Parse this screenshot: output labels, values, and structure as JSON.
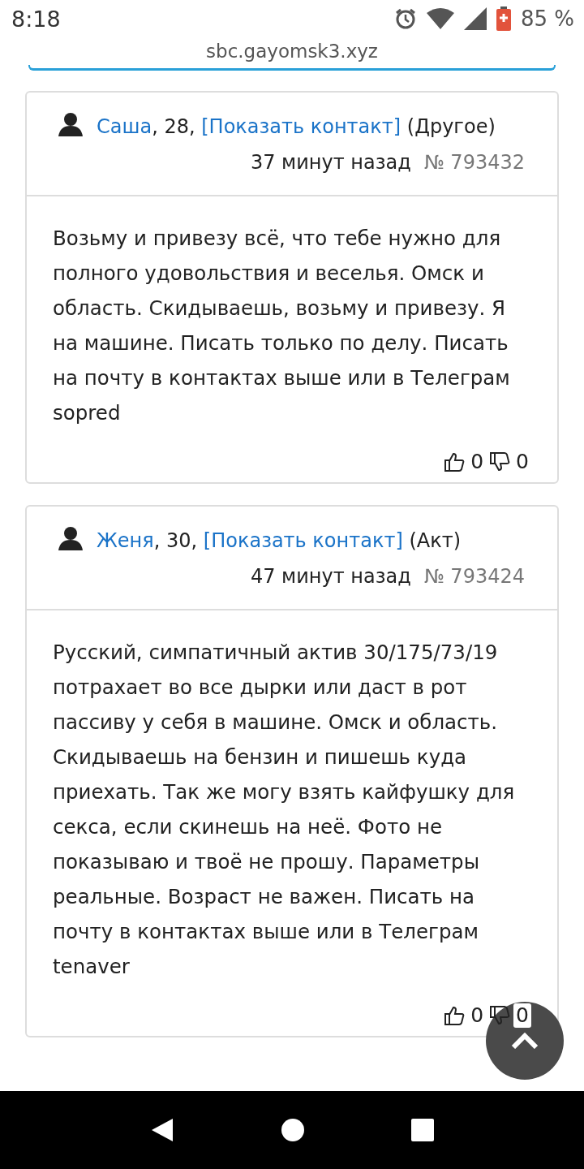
{
  "status_bar": {
    "time": "8:18",
    "battery": "85 %"
  },
  "address_bar": {
    "url": "sbc.gayomsk3.xyz"
  },
  "posts": [
    {
      "name": "Саша",
      "after_name": ", 28,",
      "contact_link": "[Показать контакт]",
      "role": "(Другое)",
      "time": "37 минут назад",
      "number": "№ 793432",
      "text": "Возьму и привезу всё, что тебе нужно для полного удовольствия и веселья. Омск и область. Скидываешь, возьму и привезу. Я на машине. Писать только по делу. Писать на почту в контактах выше или в Телеграм sopred",
      "likes": "0",
      "dislikes": "0"
    },
    {
      "name": "Женя",
      "after_name": ", 30,",
      "contact_link": "[Показать контакт]",
      "role": "(Акт)",
      "time": "47 минут назад",
      "number": "№ 793424",
      "text": "Русский, симпатичный актив 30/175/73/19 потрахает во все дырки или даст в рот пассиву у себя в машине. Омск и область. Скидываешь на бензин и пишешь куда приехать. Так же могу взять кайфушку для секса, если скинешь на неё. Фото не показываю и твоё не прошу. Параметры реальные. Возраст не важен. Писать на почту в контактах выше или в Телеграм tenaver",
      "likes": "0",
      "dislikes": "0"
    }
  ]
}
